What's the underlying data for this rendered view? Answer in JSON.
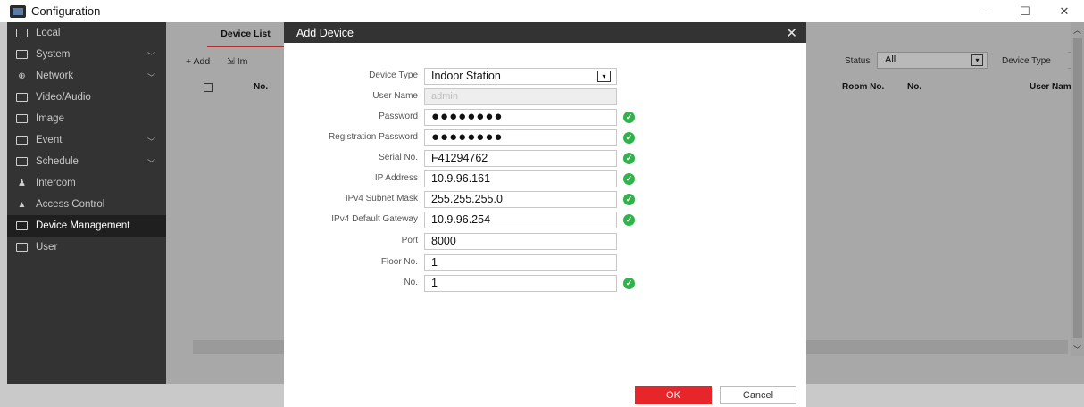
{
  "window": {
    "title": "Configuration",
    "minimize": "—",
    "maximize": "☐",
    "close": "✕"
  },
  "sidebar": {
    "items": [
      {
        "label": "Local",
        "icon": "monitor-icon"
      },
      {
        "label": "System",
        "icon": "screen-icon",
        "expandable": true
      },
      {
        "label": "Network",
        "icon": "globe-icon",
        "expandable": true
      },
      {
        "label": "Video/Audio",
        "icon": "video-icon"
      },
      {
        "label": "Image",
        "icon": "image-icon"
      },
      {
        "label": "Event",
        "icon": "calendar-icon",
        "expandable": true
      },
      {
        "label": "Schedule",
        "icon": "schedule-icon",
        "expandable": true
      },
      {
        "label": "Intercom",
        "icon": "person-icon"
      },
      {
        "label": "Access Control",
        "icon": "lock-icon"
      },
      {
        "label": "Device Management",
        "icon": "monitor-icon",
        "active": true
      },
      {
        "label": "User",
        "icon": "monitor-icon"
      }
    ],
    "chevron": "﹀"
  },
  "main": {
    "tab_device_list": "Device List",
    "add_label": "+ Add",
    "import_label": "⇲ Im",
    "status_label": "Status",
    "status_value": "All",
    "device_type_label": "Device Type",
    "columns": {
      "no": "No.",
      "room_no": "Room No.",
      "no2": "No.",
      "user_name": "User Name"
    }
  },
  "modal": {
    "title": "Add Device",
    "fields": {
      "device_type": {
        "label": "Device Type",
        "value": "Indoor Station"
      },
      "user_name": {
        "label": "User Name",
        "value": "admin"
      },
      "password": {
        "label": "Password",
        "value": "●●●●●●●●"
      },
      "registration_password": {
        "label": "Registration Password",
        "value": "●●●●●●●●"
      },
      "serial_no": {
        "label": "Serial No.",
        "value": "F41294762"
      },
      "ip_address": {
        "label": "IP Address",
        "value": "10.9.96.161"
      },
      "subnet_mask": {
        "label": "IPv4 Subnet Mask",
        "value": "255.255.255.0"
      },
      "default_gateway": {
        "label": "IPv4 Default Gateway",
        "value": "10.9.96.254"
      },
      "port": {
        "label": "Port",
        "value": "8000"
      },
      "floor_no": {
        "label": "Floor No.",
        "value": "1"
      },
      "no": {
        "label": "No.",
        "value": "1"
      }
    },
    "ok_label": "OK",
    "cancel_label": "Cancel",
    "close_icon": "✕",
    "check_mark": "✓",
    "dropdown_arrow": "▾"
  },
  "colors": {
    "sidebar_bg": "#333333",
    "modal_header_bg": "#333333",
    "ok_button": "#e6262b",
    "valid_check": "#2fb34a",
    "tab_underline": "#b03030"
  }
}
